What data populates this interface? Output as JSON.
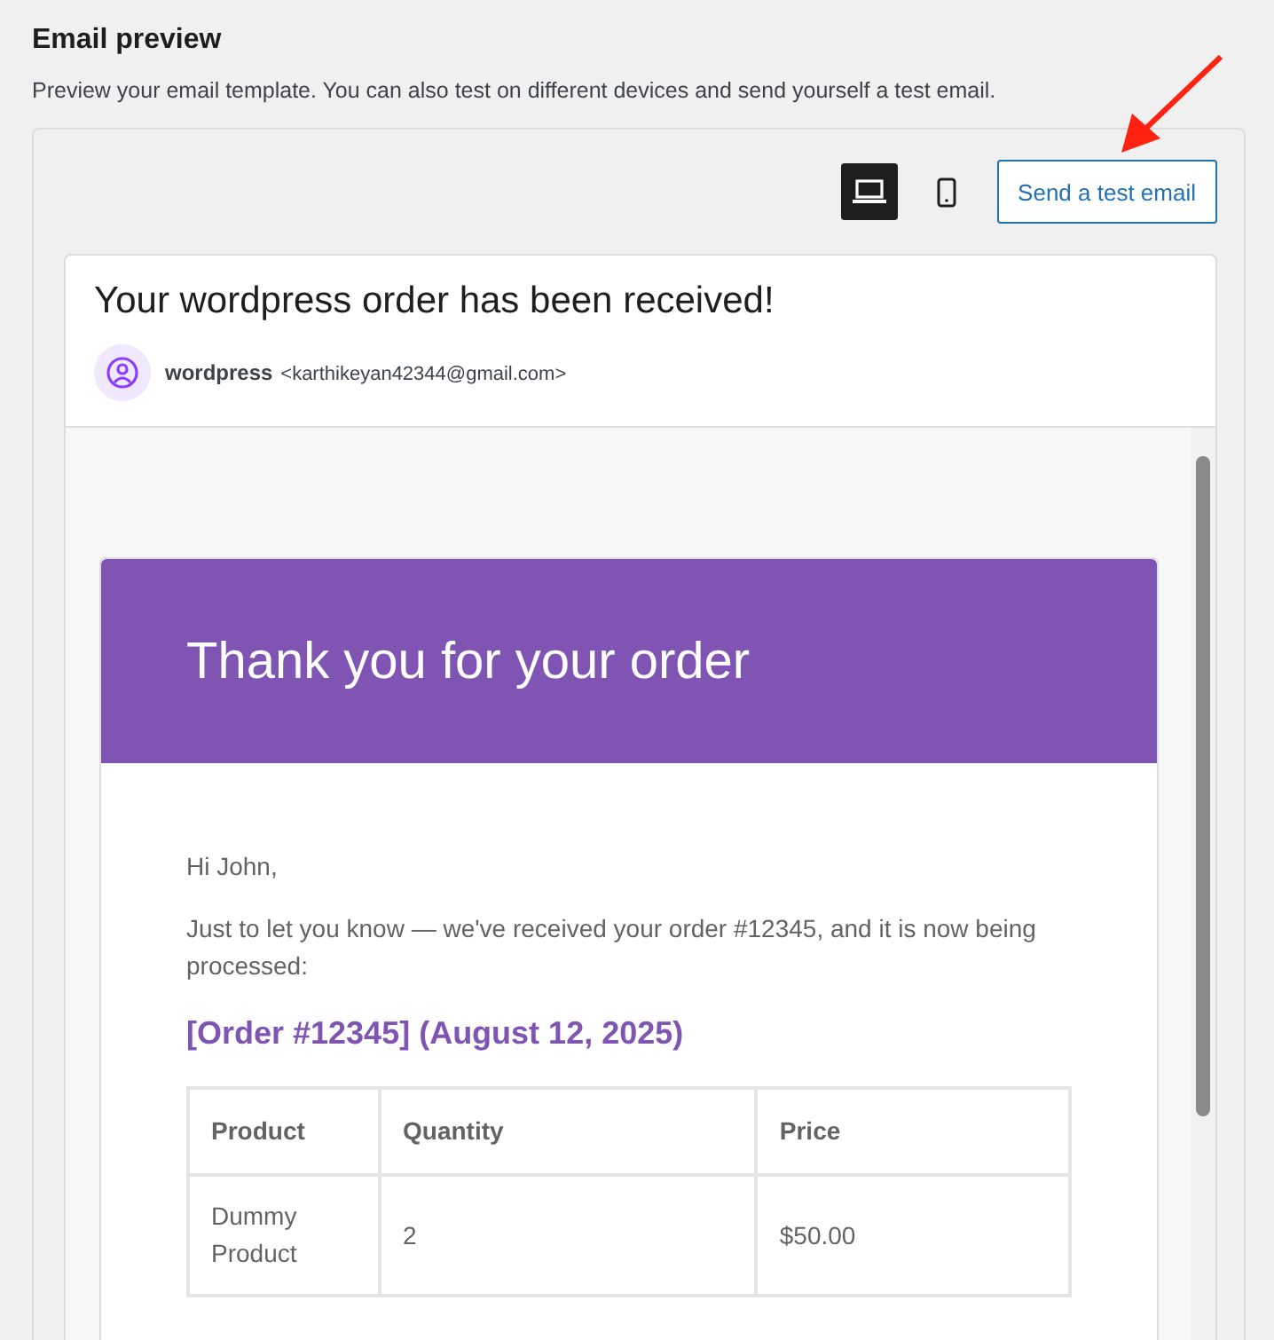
{
  "section": {
    "title": "Email preview",
    "description": "Preview your email template. You can also test on different devices and send yourself a test email."
  },
  "devices": [
    {
      "kind": "desktop",
      "selected": true
    },
    {
      "kind": "mobile",
      "selected": false
    }
  ],
  "test_button": "Send a test email",
  "email": {
    "subject": "Your wordpress order has been received!",
    "sender_name": "wordpress",
    "sender_address": "<karthikeyan42344@gmail.com>",
    "heading": "Thank you for your order",
    "greeting": "Hi John,",
    "message": "Just to let you know — we've received your order #12345, and it is now being processed:",
    "order_title": "[Order #12345] (August 12, 2025)",
    "table": {
      "columns": [
        "Product",
        "Quantity",
        "Price"
      ],
      "rows": [
        [
          "Dummy Product",
          "2",
          "$50.00"
        ]
      ]
    }
  }
}
